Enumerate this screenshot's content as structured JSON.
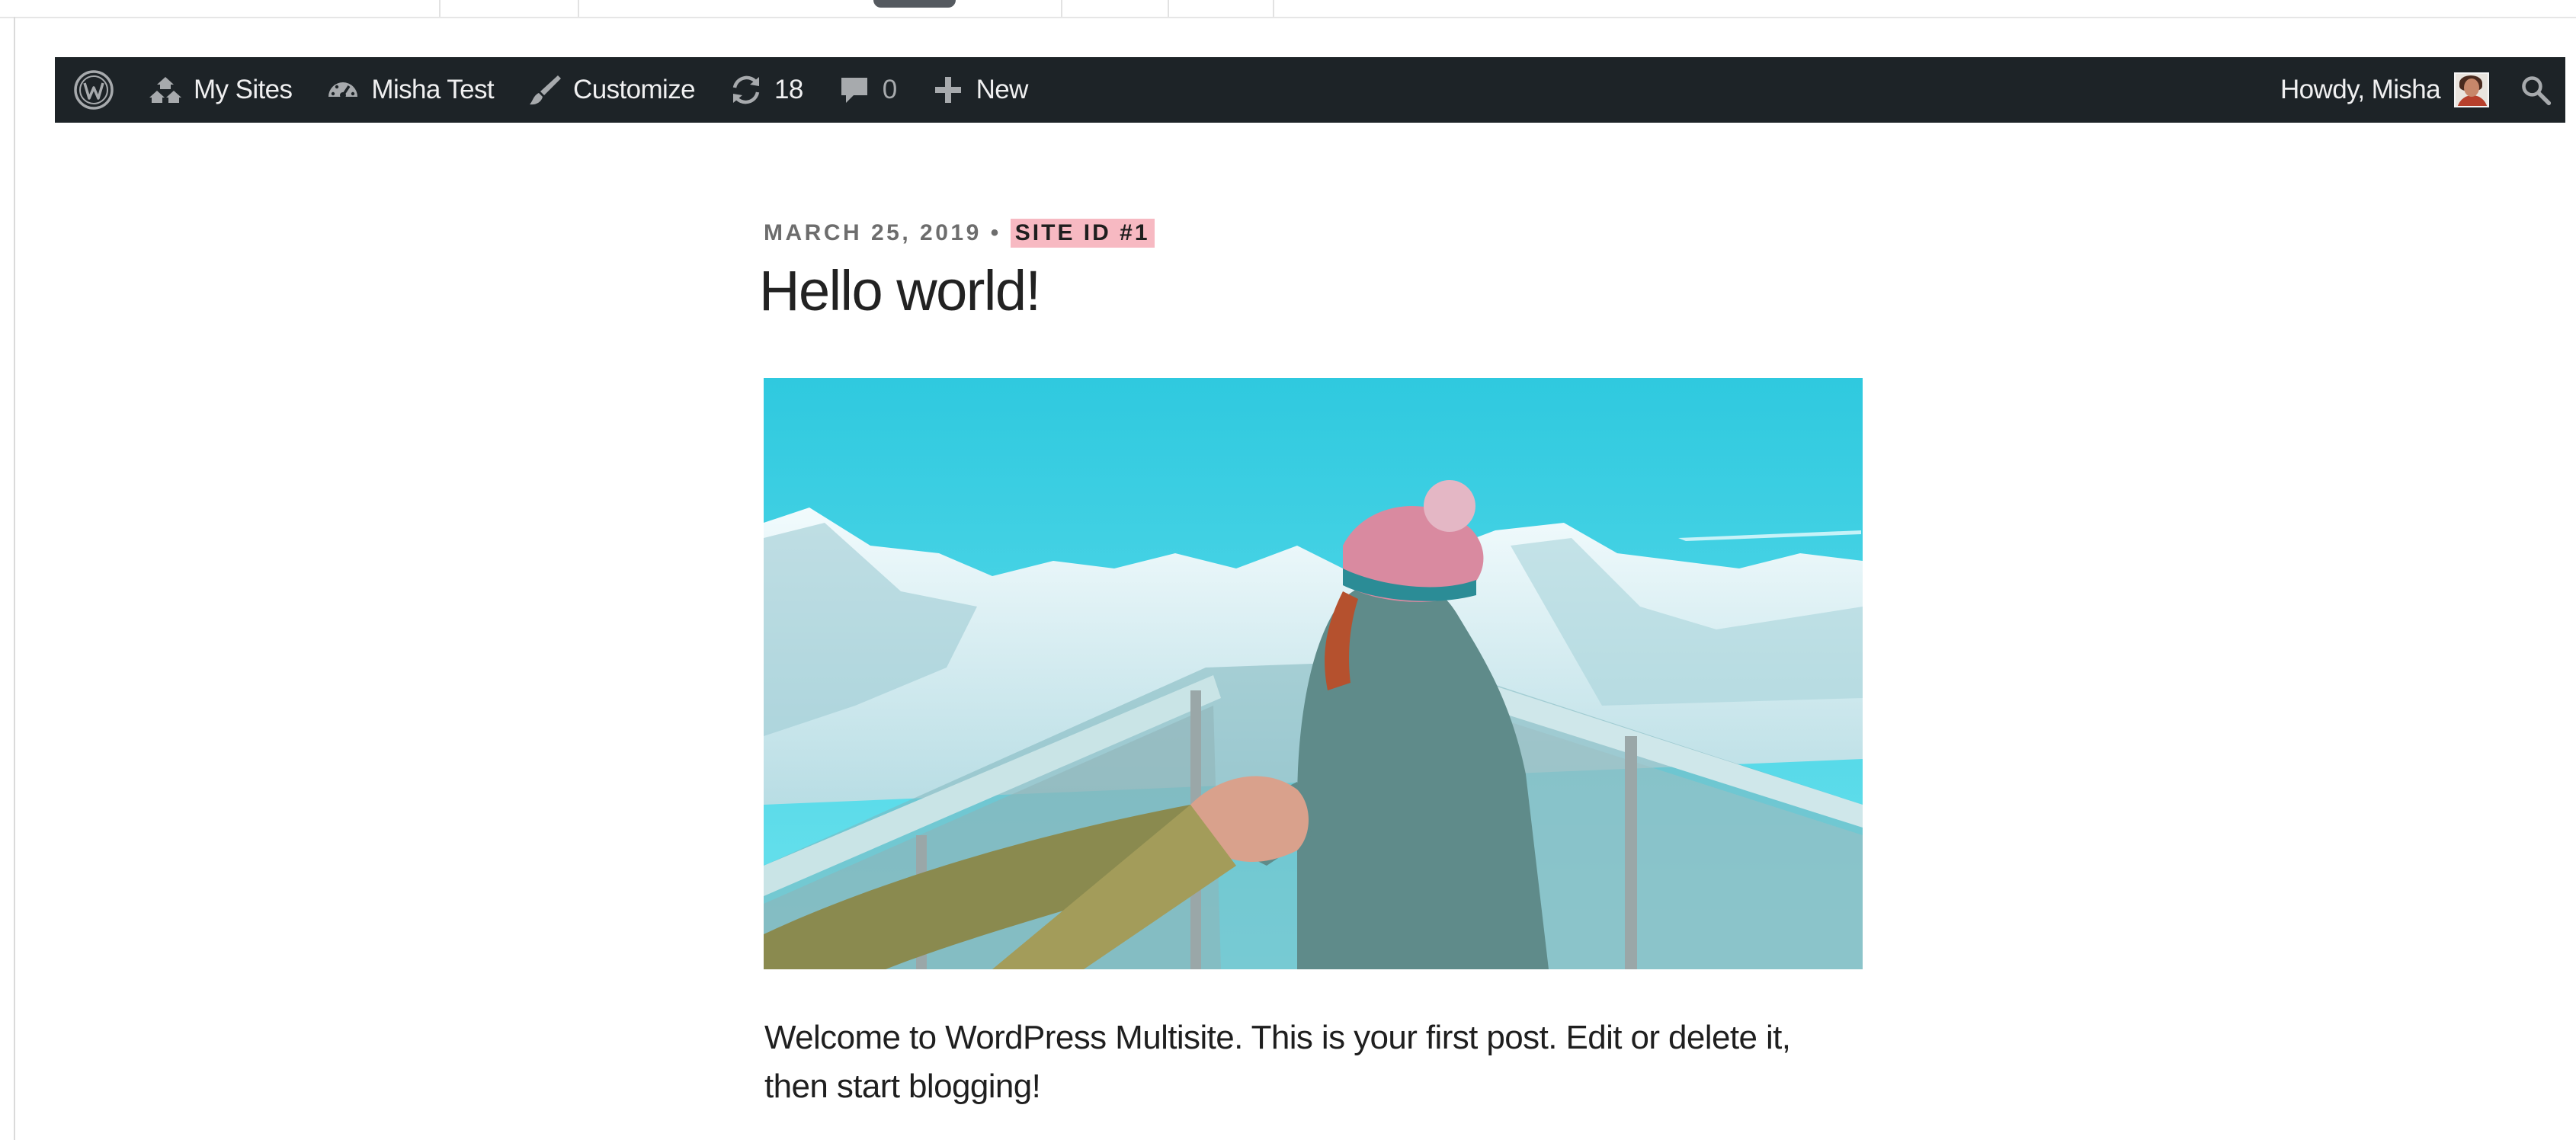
{
  "adminbar": {
    "items": [
      {
        "icon": "wordpress-logo-icon",
        "label": ""
      },
      {
        "icon": "my-sites-icon",
        "label": "My Sites"
      },
      {
        "icon": "dashboard-icon",
        "label": "Misha Test"
      },
      {
        "icon": "brush-icon",
        "label": "Customize"
      },
      {
        "icon": "updates-icon",
        "label": "18"
      },
      {
        "icon": "comments-icon",
        "label": "0"
      },
      {
        "icon": "plus-icon",
        "label": "New"
      }
    ],
    "greeting": "Howdy, Misha",
    "search_icon": "search-icon",
    "bar_color": "#1d2327"
  },
  "post": {
    "date": "MARCH 25, 2019",
    "separator": "•",
    "site_id": "SITE ID #1",
    "site_id_highlight": "#f7b9c2",
    "title": "Hello world!",
    "excerpt": "Welcome to WordPress Multisite. This is your first post. Edit or delete it, then start blogging!"
  }
}
